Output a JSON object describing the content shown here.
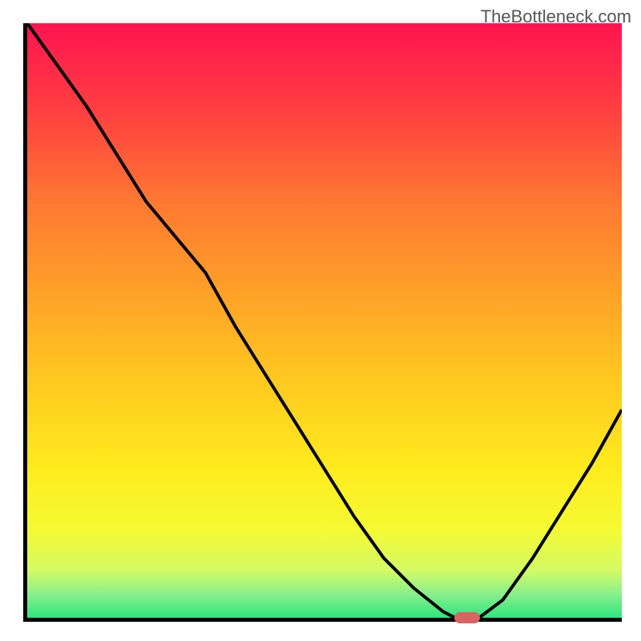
{
  "watermark": "TheBottleneck.com",
  "chart_data": {
    "type": "line",
    "title": "",
    "xlabel": "",
    "ylabel": "",
    "xlim": [
      0,
      100
    ],
    "ylim": [
      0,
      100
    ],
    "x": [
      0,
      5,
      10,
      15,
      20,
      25,
      30,
      35,
      40,
      45,
      50,
      55,
      60,
      65,
      70,
      72,
      76,
      80,
      85,
      90,
      95,
      100
    ],
    "y": [
      100,
      93,
      86,
      78,
      70,
      64,
      58,
      49,
      41,
      33,
      25,
      17,
      10,
      5,
      1,
      0,
      0,
      3,
      10,
      18,
      26,
      35
    ],
    "marker_x": 74,
    "marker_y": 0,
    "gradient_colors": {
      "top": "#ff1450",
      "upper_mid": "#ffa028",
      "mid": "#ffeb1e",
      "lower_mid": "#d4fa64",
      "bottom": "#2ee57e"
    },
    "curve_color": "#000000",
    "marker_color": "#d86464",
    "axes_color": "#000000"
  }
}
